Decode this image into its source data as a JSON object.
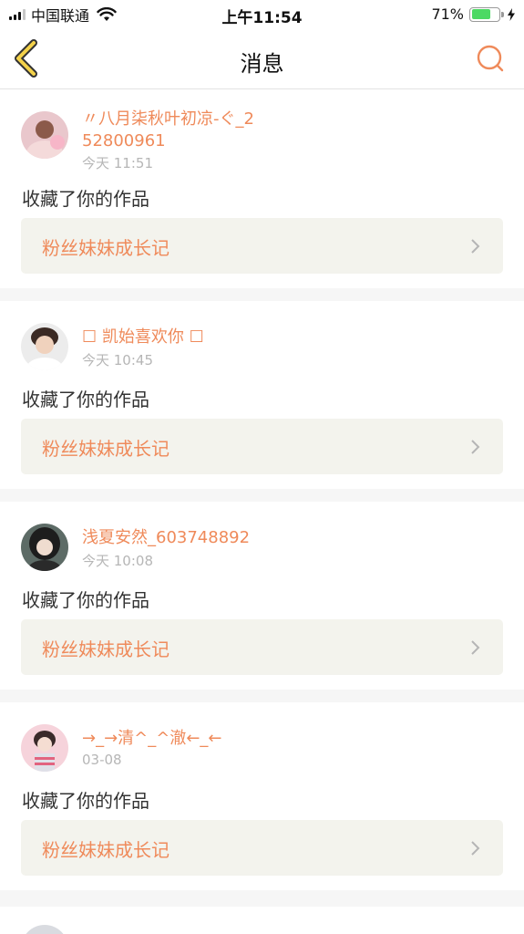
{
  "status_bar": {
    "carrier": "中国联通",
    "time": "上午11:54",
    "battery_percent": "71%"
  },
  "nav": {
    "title": "消息",
    "back_icon": "chevron-left-icon",
    "search_icon": "search-icon"
  },
  "messages": [
    {
      "username": "〃八月柒秋叶初凉-ぐ_252800961",
      "time": "今天 11:51",
      "action": "收藏了你的作品",
      "work_title": "粉丝妹妹成长记"
    },
    {
      "username": "☐ 凯始喜欢你 ☐",
      "time": "今天 10:45",
      "action": "收藏了你的作品",
      "work_title": "粉丝妹妹成长记"
    },
    {
      "username": "浅夏安然_603748892",
      "time": "今天 10:08",
      "action": "收藏了你的作品",
      "work_title": "粉丝妹妹成长记"
    },
    {
      "username": "→_→清^_^澈←_←",
      "time": "03-08",
      "action": "收藏了你的作品",
      "work_title": "粉丝妹妹成长记"
    }
  ],
  "colors": {
    "accent": "#ef8a5a",
    "nav_icon": "#e6a83a",
    "work_box": "#f3f3ed"
  }
}
